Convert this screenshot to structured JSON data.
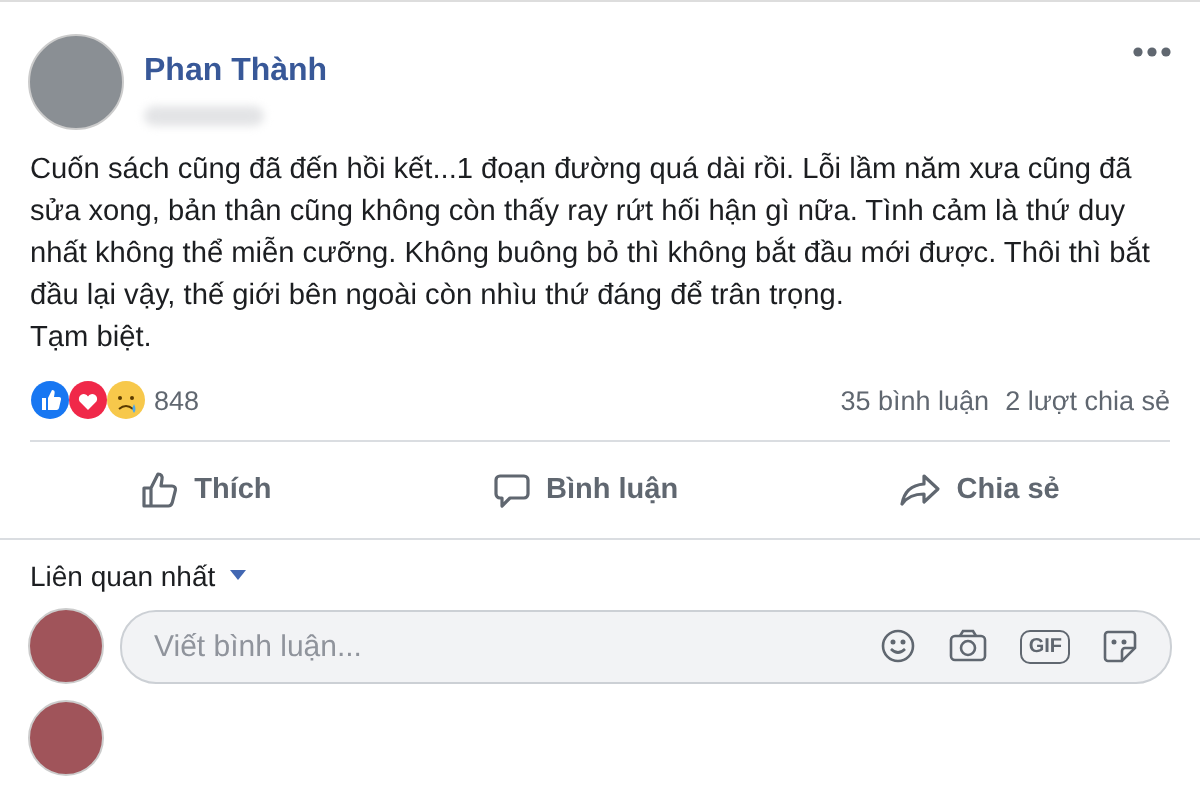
{
  "post": {
    "author": "Phan Thành",
    "text": "Cuốn sách cũng đã đến hồi kết...1 đoạn đường quá dài rồi. Lỗi lầm năm xưa cũng đã sửa xong, bản thân cũng không còn thấy ray rứt hối hận gì nữa. Tình cảm là thứ duy nhất không thể miễn cưỡng. Không buông bỏ thì không bắt đầu mới được. Thôi thì bắt đầu lại vậy, thế giới bên ngoài còn nhìu thứ đáng để trân trọng.",
    "closing": "Tạm biệt."
  },
  "reactions": {
    "count": "848",
    "comments": "35 bình luận",
    "shares": "2 lượt chia sẻ"
  },
  "actions": [
    {
      "kind": "like",
      "label": "Thích"
    },
    {
      "kind": "comment",
      "label": "Bình luận"
    },
    {
      "kind": "share",
      "label": "Chia sẻ"
    }
  ],
  "sort": {
    "label": "Liên quan nhất"
  },
  "composer": {
    "placeholder": "Viết bình luận...",
    "gif": "GIF"
  }
}
